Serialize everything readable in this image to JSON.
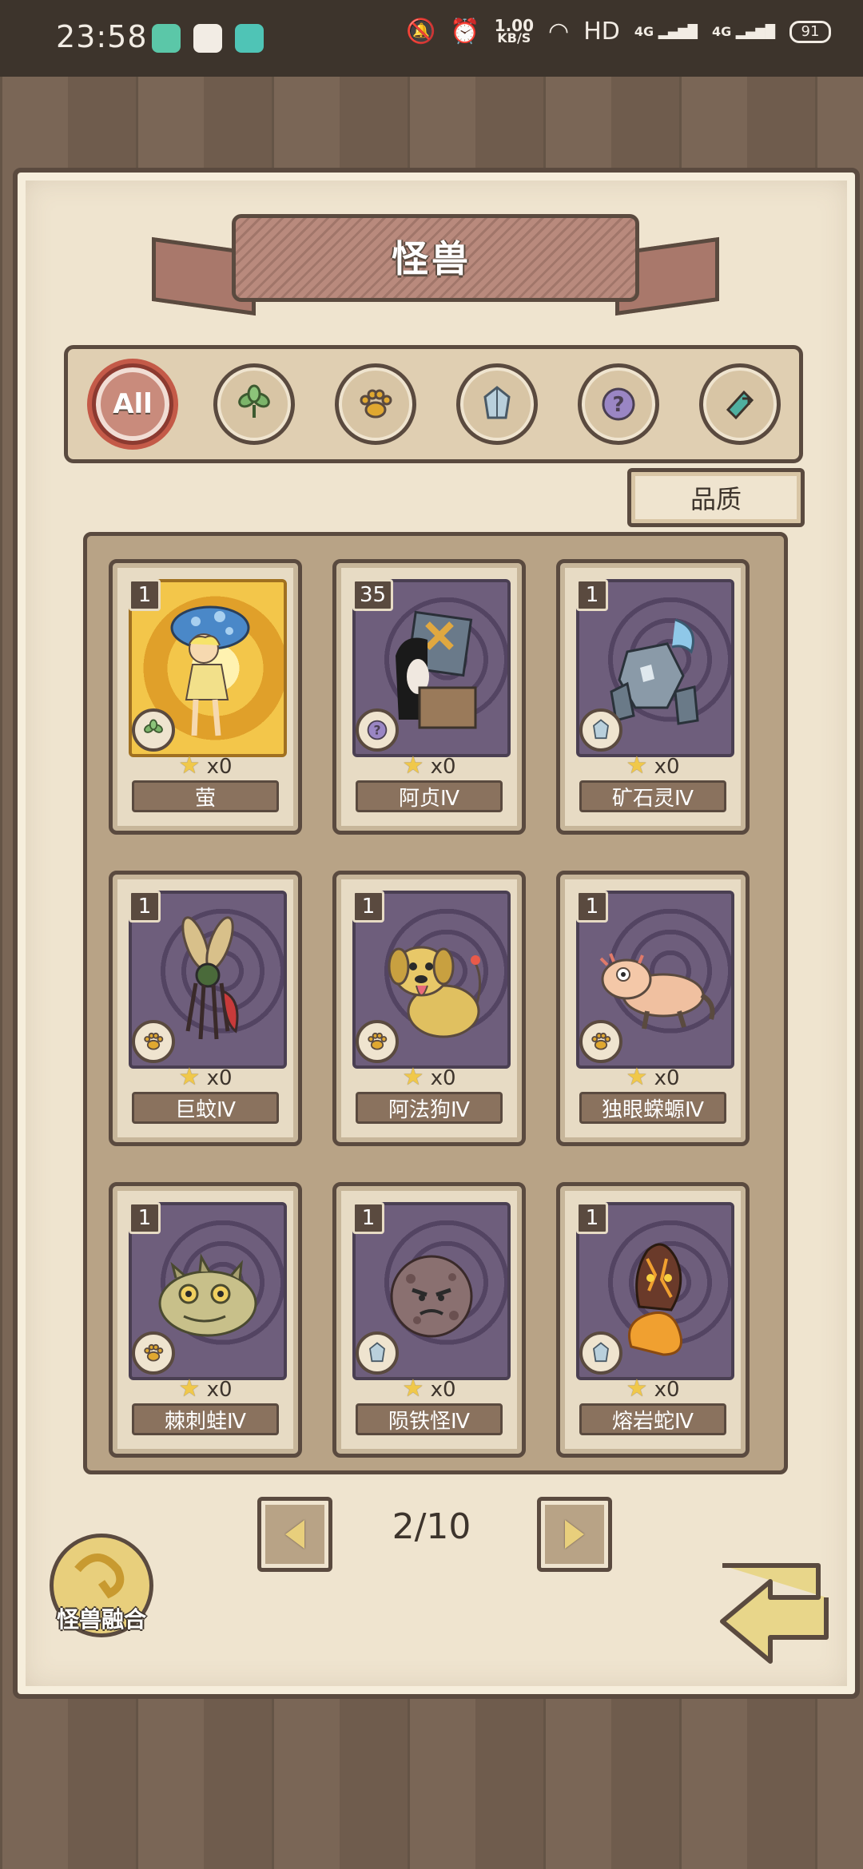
{
  "status_bar": {
    "time": "23:58",
    "speed_value": "1.00",
    "speed_unit": "KB/S",
    "hd_label": "HD",
    "net1": "4G",
    "net2": "4G",
    "battery": "91"
  },
  "header": {
    "title": "怪兽"
  },
  "filters": [
    {
      "label": "All",
      "icon": "all-icon",
      "active": true
    },
    {
      "label": "",
      "icon": "plant-icon"
    },
    {
      "label": "",
      "icon": "paw-icon"
    },
    {
      "label": "",
      "icon": "crystal-icon"
    },
    {
      "label": "",
      "icon": "question-icon"
    },
    {
      "label": "",
      "icon": "gear-icon"
    }
  ],
  "sort_button": {
    "label": "品质"
  },
  "cards": [
    {
      "count": "1",
      "stars": "x0",
      "name": "萤",
      "type_icon": "plant-icon"
    },
    {
      "count": "35",
      "stars": "x0",
      "name": "阿贞Ⅳ",
      "type_icon": "question-icon"
    },
    {
      "count": "1",
      "stars": "x0",
      "name": "矿石灵Ⅳ",
      "type_icon": "crystal-icon"
    },
    {
      "count": "1",
      "stars": "x0",
      "name": "巨蚊Ⅳ",
      "type_icon": "paw-icon"
    },
    {
      "count": "1",
      "stars": "x0",
      "name": "阿法狗Ⅳ",
      "type_icon": "paw-icon"
    },
    {
      "count": "1",
      "stars": "x0",
      "name": "独眼蝾螈Ⅳ",
      "type_icon": "paw-icon"
    },
    {
      "count": "1",
      "stars": "x0",
      "name": "棘刺蛙Ⅳ",
      "type_icon": "paw-icon"
    },
    {
      "count": "1",
      "stars": "x0",
      "name": "陨铁怪Ⅳ",
      "type_icon": "crystal-icon"
    },
    {
      "count": "1",
      "stars": "x0",
      "name": "熔岩蛇Ⅳ",
      "type_icon": "crystal-icon"
    }
  ],
  "pagination": {
    "page": "2/10"
  },
  "fusion_button": {
    "label": "怪兽融合"
  },
  "colors": {
    "wood": "#6f5c4d",
    "paper": "#efe4cf",
    "ink": "#5a4a3f",
    "card_art": "#6e5e7c",
    "accent": "#c45a48"
  }
}
